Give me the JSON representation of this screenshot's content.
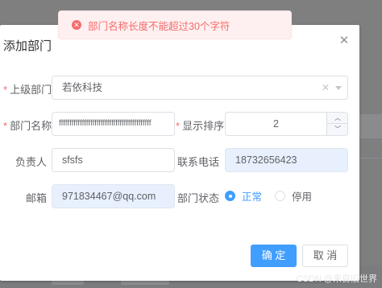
{
  "toast": {
    "icon": "close-circle-icon",
    "message": "部门名称长度不能超过30个字符"
  },
  "dialog": {
    "title": "添加部门",
    "close_icon": "close-icon"
  },
  "form": {
    "parent": {
      "label": "上级部门",
      "value": "若依科技"
    },
    "dept_name": {
      "label": "部门名称",
      "value": "ffffffffffffffffffffffffffffffffffffffffffff"
    },
    "order": {
      "label": "显示排序",
      "value": "2"
    },
    "leader": {
      "label": "负责人",
      "value": "sfsfs"
    },
    "phone": {
      "label": "联系电话",
      "value": "18732656423"
    },
    "email": {
      "label": "邮箱",
      "value": "971834467@qq.com"
    },
    "status": {
      "label": "部门状态",
      "options": [
        "正常",
        "停用"
      ],
      "selected": "正常"
    }
  },
  "footer": {
    "confirm_label": "确 定",
    "cancel_label": "取 消"
  },
  "watermark": "CSDN @来自旧世界",
  "colors": {
    "primary": "#409eff",
    "error": "#f56c6c",
    "autofill": "#e8f0fe"
  }
}
